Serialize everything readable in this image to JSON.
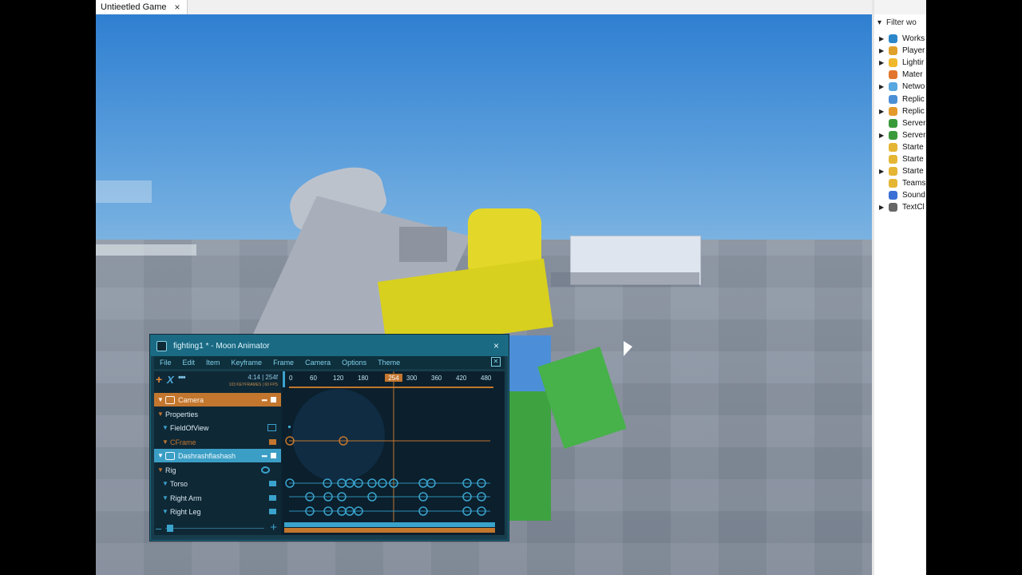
{
  "tab": {
    "title": "Untieetled Game",
    "close": "×"
  },
  "explorer": {
    "filter": "Filter wo",
    "items": [
      {
        "label": "Works",
        "expand": true,
        "color": "#2b87c9"
      },
      {
        "label": "Player",
        "expand": true,
        "color": "#e0a12a"
      },
      {
        "label": "Lightir",
        "expand": true,
        "color": "#f0b82d"
      },
      {
        "label": "Mater",
        "expand": false,
        "color": "#e2762c"
      },
      {
        "label": "Netwo",
        "expand": true,
        "color": "#57a7e0"
      },
      {
        "label": "Replic",
        "expand": false,
        "color": "#4a8fd6"
      },
      {
        "label": "Replic",
        "expand": true,
        "color": "#e39a2b"
      },
      {
        "label": "Server",
        "expand": false,
        "color": "#3a9a3a"
      },
      {
        "label": "Server",
        "expand": true,
        "color": "#3a9a3a"
      },
      {
        "label": "Starte",
        "expand": false,
        "color": "#e5b534"
      },
      {
        "label": "Starte",
        "expand": false,
        "color": "#e5b534"
      },
      {
        "label": "Starte",
        "expand": true,
        "color": "#e5b534"
      },
      {
        "label": "Teams",
        "expand": false,
        "color": "#e5b534"
      },
      {
        "label": "Sound",
        "expand": false,
        "color": "#3a6fd6"
      },
      {
        "label": "TextCl",
        "expand": true,
        "color": "#666666"
      }
    ]
  },
  "moon": {
    "title": "fighting1 * - Moon Animator",
    "close": "×",
    "menu": [
      "File",
      "Edit",
      "Item",
      "Keyframe",
      "Frame",
      "Camera",
      "Options",
      "Theme"
    ],
    "menu_close": "✕",
    "time_main": "4:14  |  254f",
    "time_sub": "103 KEYFRAMES | 60 FPS",
    "ruler": [
      "0",
      "60",
      "120",
      "180",
      "254",
      "300",
      "360",
      "420",
      "480"
    ],
    "current_frame": "254",
    "tracks": [
      {
        "label": "Camera",
        "type": "camera"
      },
      {
        "label": "Properties",
        "type": "sub"
      },
      {
        "label": "FieldOfView",
        "type": "prop"
      },
      {
        "label": "CFrame",
        "type": "prop-orange"
      },
      {
        "label": "Dashrashflashash",
        "type": "rig"
      },
      {
        "label": "Rig",
        "type": "sub"
      },
      {
        "label": "Torso",
        "type": "prop"
      },
      {
        "label": "Right Arm",
        "type": "prop"
      },
      {
        "label": "Right Leg",
        "type": "prop"
      }
    ],
    "track_dots": "•••",
    "eye_icon": "eye-icon"
  },
  "colors": {
    "accent_orange": "#c3762e",
    "accent_blue": "#3b9ec5",
    "panel": "#0c2230"
  }
}
